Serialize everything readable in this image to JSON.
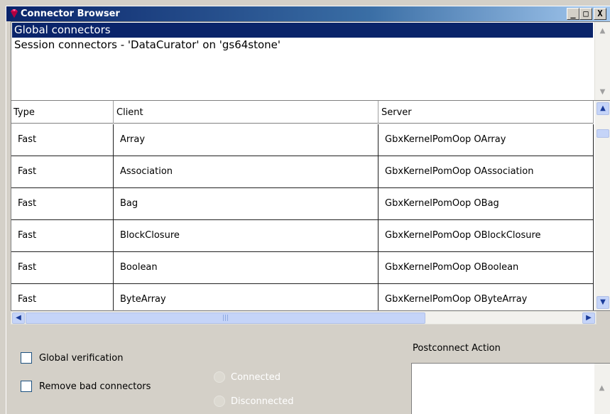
{
  "window": {
    "title": "Connector Browser",
    "icon": "gem-icon",
    "controls": {
      "minimize": "_",
      "maximize": "□",
      "close": "X"
    }
  },
  "sessions": [
    {
      "label": "Global connectors",
      "selected": true
    },
    {
      "label": "Session connectors - 'DataCurator' on 'gs64stone'",
      "selected": false
    }
  ],
  "table": {
    "columns": [
      "Type",
      "Client",
      "Server"
    ],
    "rows": [
      {
        "type": "Fast",
        "client": "Array",
        "server": "GbxKernelPomOop OArray"
      },
      {
        "type": "Fast",
        "client": "Association",
        "server": "GbxKernelPomOop OAssociation"
      },
      {
        "type": "Fast",
        "client": "Bag",
        "server": "GbxKernelPomOop OBag"
      },
      {
        "type": "Fast",
        "client": "BlockClosure",
        "server": "GbxKernelPomOop OBlockClosure"
      },
      {
        "type": "Fast",
        "client": "Boolean",
        "server": "GbxKernelPomOop OBoolean"
      },
      {
        "type": "Fast",
        "client": "ByteArray",
        "server": "GbxKernelPomOop OByteArray"
      }
    ]
  },
  "options": {
    "global_verification": "Global verification",
    "remove_bad_connectors": "Remove bad connectors",
    "connected": "Connected",
    "disconnected": "Disconnected",
    "postconnect_action_label": "Postconnect Action"
  },
  "colors": {
    "selection": "#0a246a",
    "titlebar": "#0a246a",
    "window_bg": "#d4d0c8"
  }
}
